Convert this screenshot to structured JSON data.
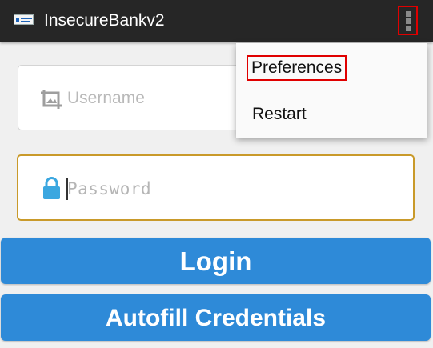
{
  "app": {
    "title": "InsecureBankv2",
    "logo_icon": "app-logo-icon",
    "overflow_icon": "more-vert-icon"
  },
  "form": {
    "username": {
      "placeholder": "Username",
      "icon": "crop-icon"
    },
    "password": {
      "placeholder": "Password",
      "icon": "lock-icon"
    }
  },
  "buttons": {
    "login": "Login",
    "autofill": "Autofill Credentials"
  },
  "menu": {
    "items": [
      {
        "label": "Preferences"
      },
      {
        "label": "Restart"
      }
    ]
  },
  "colors": {
    "appbar": "#262626",
    "button": "#2e8ad8",
    "focus_border": "#c99a2a",
    "lock": "#3ba7e0",
    "highlight": "#e00000"
  }
}
